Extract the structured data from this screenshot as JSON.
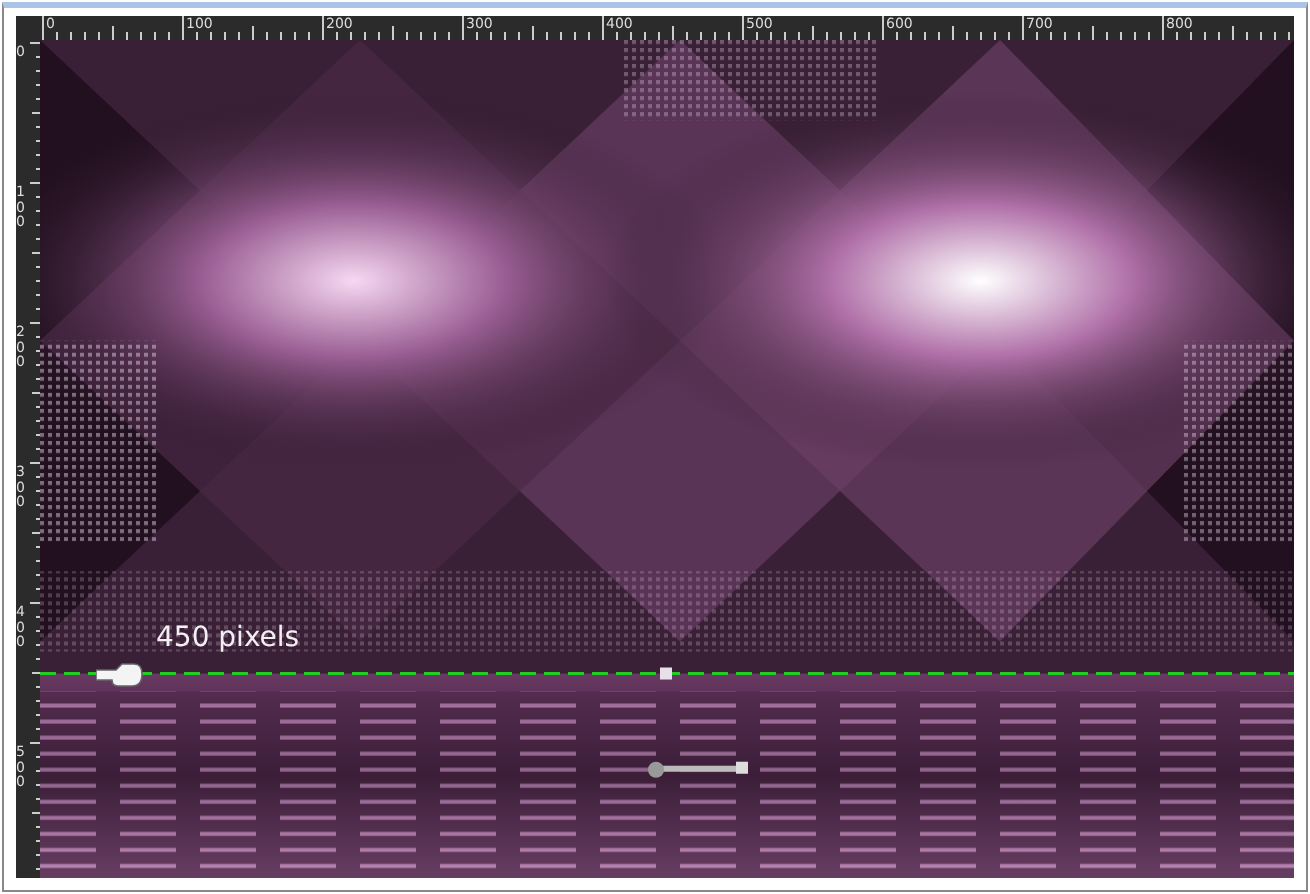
{
  "top_ruler": {
    "labels": [
      "0",
      "100",
      "200",
      "300",
      "400",
      "500",
      "600",
      "700",
      "800"
    ]
  },
  "left_ruler": {
    "labels": [
      "0",
      "100",
      "200",
      "300",
      "400",
      "500"
    ]
  },
  "guide": {
    "label": "450 pixels"
  }
}
